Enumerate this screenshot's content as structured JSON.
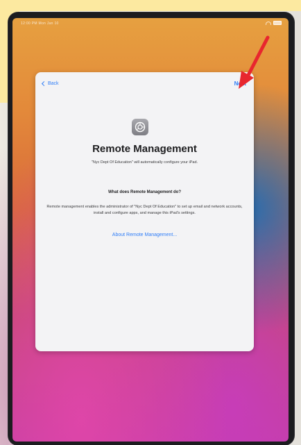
{
  "status_bar": {
    "left_text": "12:00 PM  Mon Jan 10",
    "wifi_icon": "wifi-icon",
    "battery_icon": "battery-icon"
  },
  "setup_screen": {
    "back_label": "Back",
    "next_label": "Next",
    "icon": "settings-gear-icon",
    "title": "Remote Management",
    "subtitle": "\"Nyc Dept Of Education\" will automatically configure your iPad.",
    "question": "What does Remote Management do?",
    "body": "Remote management enables the administrator of \"Nyc Dept Of Education\" to set up email and network accounts, install and configure apps, and manage this iPad's settings.",
    "about_link": "About Remote Management..."
  },
  "annotation": {
    "arrow_color": "#e8262e",
    "accent_color": "#2f7df6"
  }
}
